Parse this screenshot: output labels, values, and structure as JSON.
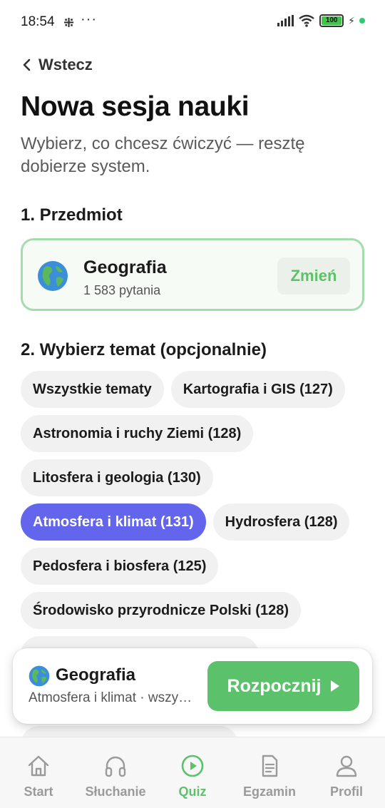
{
  "status_bar": {
    "time": "18:54",
    "dots": "···",
    "battery": "100"
  },
  "header": {
    "back_label": "Wstecz",
    "title": "Nowa sesja nauki",
    "subtitle": "Wybierz, co chcesz ćwiczyć — resztę dobierze system."
  },
  "subject_section": {
    "heading": "1. Przedmiot",
    "subject_name": "Geografia",
    "question_count": "1 583 pytania",
    "change_label": "Zmień"
  },
  "topic_section": {
    "heading": "2. Wybierz temat (opcjonalnie)",
    "chips": [
      {
        "label": "Wszystkie tematy",
        "selected": false
      },
      {
        "label": "Kartografia i GIS (127)",
        "selected": false
      },
      {
        "label": "Astronomia i ruchy Ziemi (128)",
        "selected": false
      },
      {
        "label": "Litosfera i geologia (130)",
        "selected": false
      },
      {
        "label": "Atmosfera i klimat (131)",
        "selected": true
      },
      {
        "label": "Hydrosfera (128)",
        "selected": false
      },
      {
        "label": "Pedosfera i biosfera (125)",
        "selected": false
      },
      {
        "label": "Środowisko przyrodnicze Polski (128)",
        "selected": false
      }
    ]
  },
  "start_bar": {
    "subject": "Geografia",
    "topic_summary": "Atmosfera i klimat · wszy…",
    "start_label": "Rozpocznij"
  },
  "bottom_nav": {
    "items": [
      {
        "label": "Start",
        "icon": "home-icon",
        "active": false
      },
      {
        "label": "Słuchanie",
        "icon": "headphones-icon",
        "active": false
      },
      {
        "label": "Quiz",
        "icon": "play-circle-icon",
        "active": true
      },
      {
        "label": "Egzamin",
        "icon": "document-icon",
        "active": false
      },
      {
        "label": "Profil",
        "icon": "user-icon",
        "active": false
      }
    ]
  },
  "colors": {
    "accent_green": "#5bc26b",
    "selected_chip": "#6366ec",
    "card_border": "#a4dcab"
  }
}
